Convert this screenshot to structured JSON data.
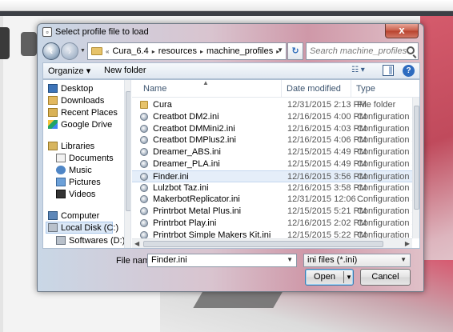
{
  "dialog": {
    "title": "Select profile file to load",
    "close_glyph": "x"
  },
  "address": {
    "overflow": "«",
    "crumbs": [
      "Cura_6.4",
      "resources",
      "machine_profiles"
    ],
    "separator": "▸",
    "search_placeholder": "Search machine_profiles"
  },
  "toolbar": {
    "organize_label": "Organize ▾",
    "new_folder_label": "New folder",
    "help_label": "?"
  },
  "nav": {
    "items": [
      {
        "label": "Desktop",
        "icon": "desktop-icon"
      },
      {
        "label": "Downloads",
        "icon": "downloads-icon"
      },
      {
        "label": "Recent Places",
        "icon": "recent-places-icon"
      },
      {
        "label": "Google Drive",
        "icon": "google-drive-icon"
      },
      {
        "label": "Libraries",
        "icon": "libraries-icon"
      },
      {
        "label": "Documents",
        "icon": "documents-icon"
      },
      {
        "label": "Music",
        "icon": "music-icon"
      },
      {
        "label": "Pictures",
        "icon": "pictures-icon"
      },
      {
        "label": "Videos",
        "icon": "videos-icon"
      },
      {
        "label": "Computer",
        "icon": "computer-icon"
      },
      {
        "label": "Local Disk (C:)",
        "icon": "local-disk-icon"
      },
      {
        "label": "Softwares (D:)",
        "icon": "disk-icon"
      }
    ],
    "selected": "Local Disk (C:)"
  },
  "files": {
    "columns": {
      "name": "Name",
      "date": "Date modified",
      "type": "Type"
    },
    "rows": [
      {
        "name": "Cura",
        "date": "12/31/2015 2:13 PM",
        "type": "File folder",
        "icon": "folder-icon"
      },
      {
        "name": "Creatbot DM2.ini",
        "date": "12/16/2015 4:00 PM",
        "type": "Configuration set",
        "icon": "config-file-icon"
      },
      {
        "name": "Creatbot DMMini2.ini",
        "date": "12/16/2015 4:03 PM",
        "type": "Configuration set",
        "icon": "config-file-icon"
      },
      {
        "name": "Creatbot DMPlus2.ini",
        "date": "12/16/2015 4:06 PM",
        "type": "Configuration set",
        "icon": "config-file-icon"
      },
      {
        "name": "Dreamer_ABS.ini",
        "date": "12/15/2015 4:49 PM",
        "type": "Configuration set",
        "icon": "config-file-icon"
      },
      {
        "name": "Dreamer_PLA.ini",
        "date": "12/15/2015 4:49 PM",
        "type": "Configuration set",
        "icon": "config-file-icon"
      },
      {
        "name": "Finder.ini",
        "date": "12/16/2015 3:56 PM",
        "type": "Configuration set",
        "icon": "config-file-icon"
      },
      {
        "name": "Lulzbot Taz.ini",
        "date": "12/16/2015 3:58 PM",
        "type": "Configuration set",
        "icon": "config-file-icon"
      },
      {
        "name": "MakerbotReplicator.ini",
        "date": "12/31/2015 12:06 ...",
        "type": "Configuration set",
        "icon": "config-file-icon"
      },
      {
        "name": "Printrbot Metal Plus.ini",
        "date": "12/15/2015 5:21 PM",
        "type": "Configuration set",
        "icon": "config-file-icon"
      },
      {
        "name": "Printrbot Play.ini",
        "date": "12/16/2015 2:02 PM",
        "type": "Configuration set",
        "icon": "config-file-icon"
      },
      {
        "name": "Printrbot Simple Makers Kit.ini",
        "date": "12/15/2015 5:22 PM",
        "type": "Configuration set",
        "icon": "config-file-icon"
      }
    ],
    "selected": "Finder.ini"
  },
  "footer": {
    "file_name_label": "File name:",
    "file_name_value": "Finder.ini",
    "filter_value": "ini files (*.ini)",
    "open_label": "Open",
    "cancel_label": "Cancel"
  }
}
